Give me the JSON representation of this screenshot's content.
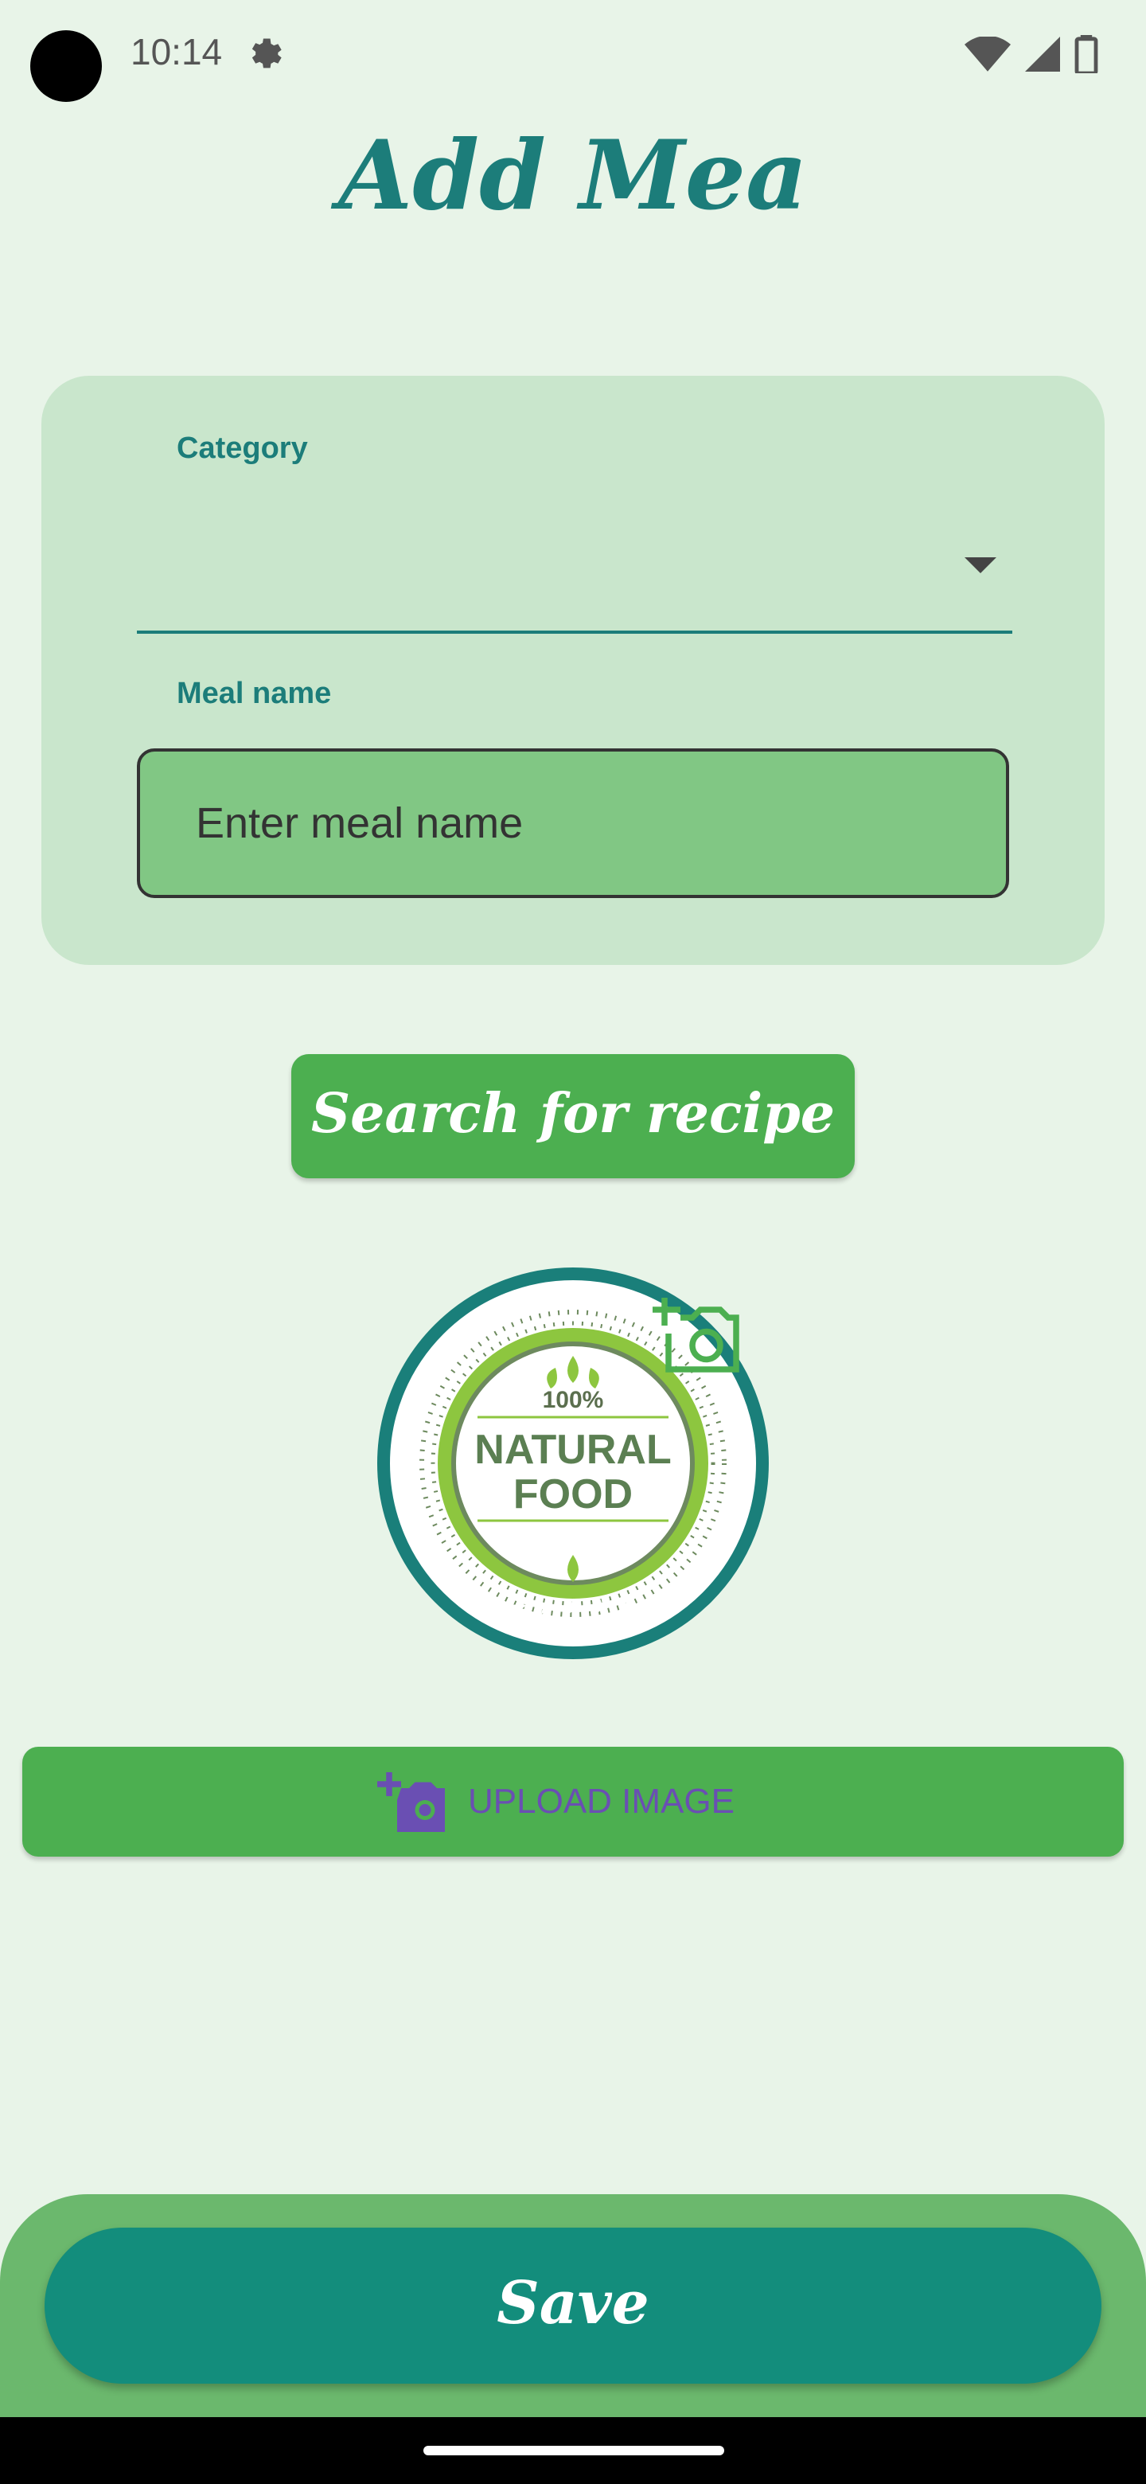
{
  "status": {
    "time": "10:14"
  },
  "page": {
    "title": "Add Mea"
  },
  "form": {
    "category_label": "Category",
    "meal_name_label": "Meal name",
    "meal_name_placeholder": "Enter meal name"
  },
  "actions": {
    "search_recipe": "Search for recipe",
    "upload_image": "UPLOAD IMAGE",
    "save": "Save"
  },
  "image_badge": {
    "top_text": "100%",
    "line1": "NATURAL",
    "line2": "FOOD"
  },
  "icons": [
    "gear-icon",
    "wifi-icon",
    "signal-icon",
    "battery-icon",
    "chevron-down-icon",
    "add-photo-icon",
    "camera-plus-icon"
  ]
}
